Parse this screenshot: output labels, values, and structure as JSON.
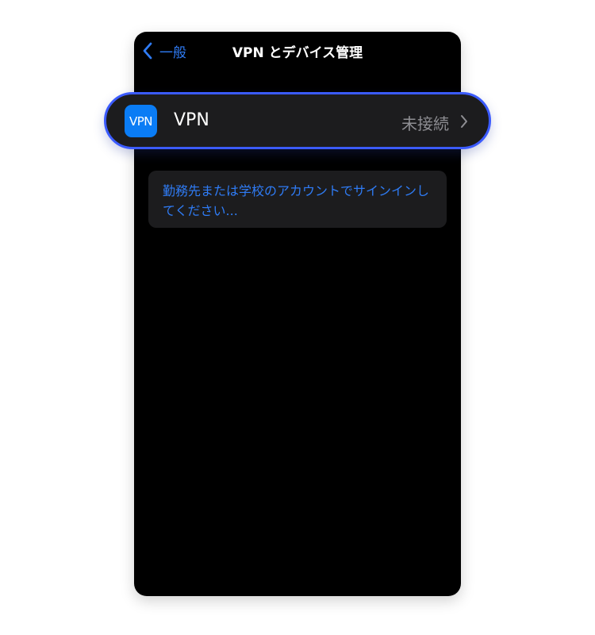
{
  "navbar": {
    "back_label": "一般",
    "title": "VPN とデバイス管理"
  },
  "vpn_row": {
    "icon_text": "VPN",
    "label": "VPN",
    "status": "未接続"
  },
  "signin_card": {
    "text": "勤務先または学校のアカウントでサインインしてください..."
  },
  "colors": {
    "accent": "#2f7cf6",
    "highlight_border": "#3b5bff",
    "background": "#000000",
    "cell": "#1c1c1e",
    "secondary_text": "#8e8e93"
  },
  "icons": {
    "back": "chevron-left-icon",
    "row_disclosure": "chevron-right-icon"
  }
}
